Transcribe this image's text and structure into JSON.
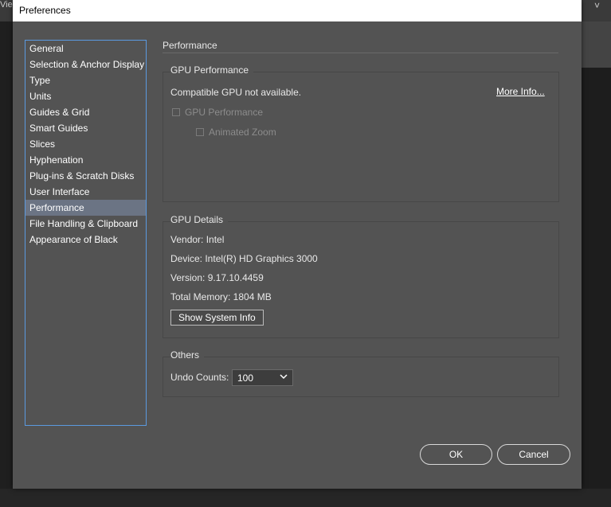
{
  "app": {
    "top_left_text": "Vie",
    "top_right_glyph": "˅"
  },
  "dialog": {
    "title": "Preferences",
    "sidebar": {
      "items": [
        {
          "label": "General"
        },
        {
          "label": "Selection & Anchor Display"
        },
        {
          "label": "Type"
        },
        {
          "label": "Units"
        },
        {
          "label": "Guides & Grid"
        },
        {
          "label": "Smart Guides"
        },
        {
          "label": "Slices"
        },
        {
          "label": "Hyphenation"
        },
        {
          "label": "Plug-ins & Scratch Disks"
        },
        {
          "label": "User Interface"
        },
        {
          "label": "Performance",
          "selected": true
        },
        {
          "label": "File Handling & Clipboard"
        },
        {
          "label": "Appearance of Black"
        }
      ]
    },
    "section_title": "Performance",
    "gpu_performance": {
      "title": "GPU Performance",
      "status": "Compatible GPU not available.",
      "more_info": "More Info...",
      "gpu_checkbox": {
        "label": "GPU Performance",
        "checked": false,
        "enabled": false
      },
      "zoom_checkbox": {
        "label": "Animated Zoom",
        "checked": false,
        "enabled": false
      }
    },
    "gpu_details": {
      "title": "GPU Details",
      "vendor": "Vendor: Intel",
      "device": "Device: Intel(R) HD Graphics 3000",
      "version": "Version: 9.17.10.4459",
      "memory": "Total Memory: 1804 MB",
      "show_button": "Show System Info"
    },
    "others": {
      "title": "Others",
      "undo_label": "Undo Counts:",
      "undo_value": "100"
    },
    "buttons": {
      "ok": "OK",
      "cancel": "Cancel"
    }
  },
  "colors": {
    "dialog_bg": "#535353",
    "accent_border": "#5b9ae0",
    "selected_item_bg": "#6b7484"
  }
}
